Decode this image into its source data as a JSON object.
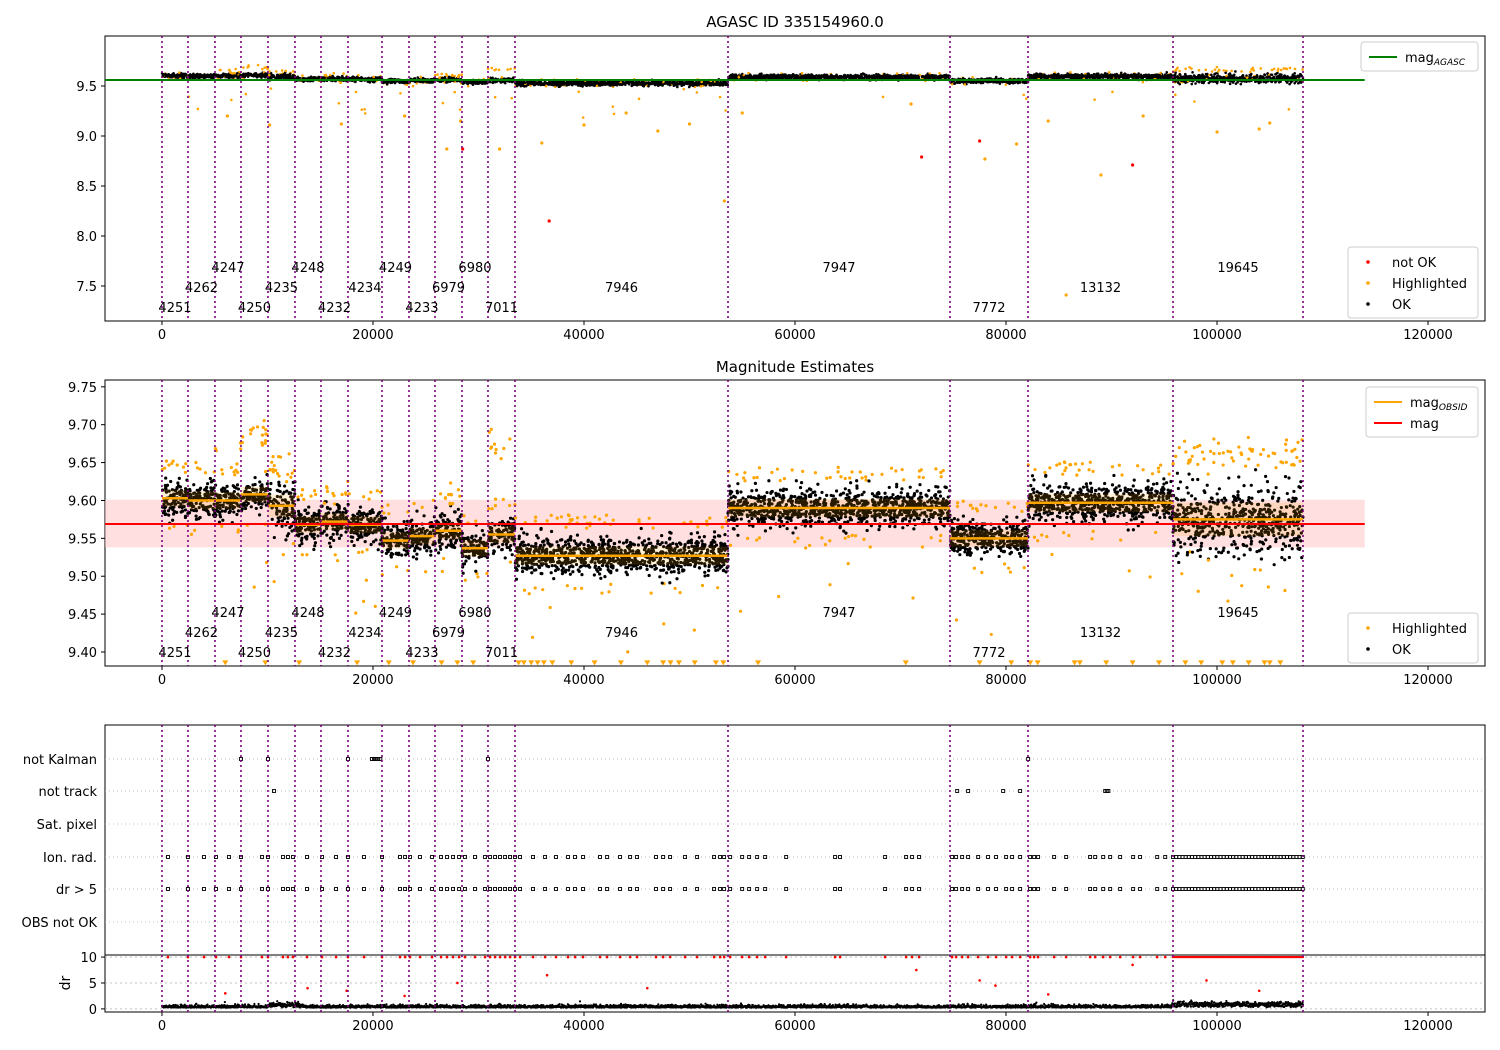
{
  "chart_data": [
    {
      "type": "scatter",
      "title": "AGASC ID 335154960.0",
      "xlabel": "",
      "ylabel": "",
      "xlim": [
        -5400,
        125400
      ],
      "ylim": [
        7.15,
        10.0
      ],
      "x_ticks": [
        0,
        20000,
        40000,
        60000,
        80000,
        100000,
        120000
      ],
      "y_ticks": [
        7.5,
        8.0,
        8.5,
        9.0,
        9.5
      ],
      "mag_agasc": 9.56,
      "legend_upper": {
        "position": "top-right",
        "entries": [
          {
            "label": "mag",
            "sub": "AGASC",
            "color": "#008000"
          }
        ]
      },
      "legend_lower": {
        "position": "bottom-right",
        "entries": [
          {
            "label": "not OK",
            "color": "#ff0000"
          },
          {
            "label": "Highlighted",
            "color": "#ffa500"
          },
          {
            "label": "OK",
            "color": "#000000"
          }
        ]
      },
      "not_ok_points": [
        [
          28500,
          8.87
        ],
        [
          36700,
          8.15
        ],
        [
          72000,
          8.79
        ],
        [
          77500,
          8.95
        ],
        [
          92000,
          8.71
        ]
      ],
      "highlighted_outliers": [
        [
          6200,
          9.2
        ],
        [
          10200,
          9.11
        ],
        [
          17000,
          9.12
        ],
        [
          23000,
          9.2
        ],
        [
          27000,
          8.87
        ],
        [
          28300,
          9.15
        ],
        [
          32000,
          8.87
        ],
        [
          36000,
          8.93
        ],
        [
          40000,
          9.11
        ],
        [
          44000,
          9.23
        ],
        [
          47000,
          9.05
        ],
        [
          50000,
          9.12
        ],
        [
          53300,
          8.35
        ],
        [
          55000,
          9.23
        ],
        [
          71000,
          9.32
        ],
        [
          78000,
          8.77
        ],
        [
          81000,
          8.92
        ],
        [
          84000,
          9.15
        ],
        [
          85700,
          7.41
        ],
        [
          89000,
          8.61
        ],
        [
          93000,
          9.2
        ],
        [
          100000,
          9.04
        ],
        [
          104000,
          9.07
        ],
        [
          105000,
          9.13
        ]
      ]
    },
    {
      "type": "scatter",
      "title": "Magnitude Estimates",
      "xlim": [
        -5400,
        125400
      ],
      "ylim": [
        9.3815,
        9.759
      ],
      "x_ticks": [
        0,
        20000,
        40000,
        60000,
        80000,
        100000,
        120000
      ],
      "y_ticks": [
        9.4,
        9.45,
        9.5,
        9.55,
        9.6,
        9.65,
        9.7,
        9.75
      ],
      "mag": 9.569,
      "mag_band": [
        9.538,
        9.601
      ],
      "legend_upper": {
        "position": "top-right",
        "entries": [
          {
            "label": "mag",
            "sub": "OBSID",
            "color": "#ffa500"
          },
          {
            "label": "mag",
            "sub": "",
            "color": "#ff0000"
          }
        ]
      },
      "legend_lower": {
        "position": "bottom-right",
        "entries": [
          {
            "label": "Highlighted",
            "color": "#ffa500"
          },
          {
            "label": "OK",
            "color": "#000000"
          }
        ]
      },
      "below_range_markers": [
        6000,
        9800,
        13000,
        18500,
        21500,
        23800,
        26500,
        28000,
        29500,
        33800,
        34300,
        35000,
        35600,
        36200,
        37000,
        38800,
        41000,
        43500,
        46000,
        47500,
        48200,
        49000,
        50500,
        52500,
        53200,
        56500,
        70500,
        77500,
        80500,
        82300,
        83000,
        86500,
        87000,
        89500,
        92000,
        94500,
        97000,
        98500,
        100500,
        101500,
        103000,
        104500,
        105000,
        106000
      ]
    },
    {
      "type": "scatter",
      "title": "",
      "xlim": [
        -5400,
        125400
      ],
      "flag_rows": [
        "not Kalman",
        "not track",
        "Sat. pixel",
        "Ion. rad.",
        "dr > 5",
        "OBS not OK"
      ],
      "not_kalman": [
        7490,
        10050,
        17630,
        19900,
        20100,
        20300,
        20500,
        20700,
        30900,
        82100
      ],
      "not_track": [
        10620,
        75370,
        76410,
        79730,
        81340,
        89400,
        89550,
        89700
      ],
      "ion_rad": [
        570,
        2460,
        3980,
        5120,
        6350,
        7490,
        9480,
        10050,
        11470,
        11940,
        12420,
        13750,
        15170,
        16500,
        17630,
        19150,
        20860,
        22560,
        23040,
        23510,
        24460,
        25600,
        26450,
        27020,
        27590,
        28160,
        28720,
        29670,
        30620,
        31090,
        31570,
        32040,
        32520,
        32990,
        33460,
        33940,
        35170,
        36310,
        37350,
        38490,
        39150,
        39910,
        41520,
        42190,
        43420,
        44370,
        45030,
        46830,
        47500,
        48160,
        49580,
        50720,
        52330,
        52900,
        53280,
        53850,
        54990,
        55650,
        56410,
        57170,
        59160,
        63800,
        64270,
        68540,
        70530,
        71100,
        71760,
        74890,
        75270,
        75840,
        76410,
        77360,
        78300,
        79060,
        80010,
        80580,
        81340,
        82280,
        82660,
        83040,
        84560,
        85700,
        87970,
        88450,
        89210,
        89870,
        90820,
        92050,
        92710,
        94330,
        95090
      ],
      "ion_rad_continuous": [
        95829,
        108152
      ],
      "dr_ylabel": "dr",
      "dr_ticks": [
        0,
        5,
        10
      ],
      "dr_ylim": [
        -0.6,
        10.4
      ],
      "dr_mid_values": [
        [
          6000,
          3
        ],
        [
          13800,
          4
        ],
        [
          17500,
          3.5
        ],
        [
          23000,
          2.5
        ],
        [
          28000,
          5
        ],
        [
          36500,
          6.5
        ],
        [
          46000,
          4
        ],
        [
          71500,
          7.5
        ],
        [
          77500,
          5.5
        ],
        [
          79000,
          4.5
        ],
        [
          84000,
          2.8
        ],
        [
          92000,
          8.5
        ],
        [
          99000,
          5.5
        ],
        [
          104000,
          3.5
        ]
      ]
    }
  ],
  "obsid_boundaries": [
    0,
    2464,
    5024,
    7488,
    10047,
    12607,
    15071,
    17630,
    20853,
    23412,
    25877,
    28436,
    30900,
    33460,
    53650,
    74692,
    82085,
    95829,
    108152
  ],
  "segments": [
    {
      "obsid": "4251",
      "mean": 9.603,
      "std": 0.011,
      "row": 0
    },
    {
      "obsid": "4262",
      "mean": 9.6,
      "std": 0.012,
      "row": 1
    },
    {
      "obsid": "4247",
      "mean": 9.6,
      "std": 0.011,
      "row": 2,
      "highlight_mag": 9.655
    },
    {
      "obsid": "4250",
      "mean": 9.608,
      "std": 0.01,
      "row": 0,
      "highlight_mag": 9.69
    },
    {
      "obsid": "4235",
      "mean": 9.593,
      "std": 0.015,
      "row": 1,
      "highlight_mag": 9.64
    },
    {
      "obsid": "4248",
      "mean": 9.568,
      "std": 0.011,
      "row": 2
    },
    {
      "obsid": "4232",
      "mean": 9.572,
      "std": 0.011,
      "row": 0,
      "highlight_mag": 9.605
    },
    {
      "obsid": "4234",
      "mean": 9.568,
      "std": 0.011,
      "row": 1
    },
    {
      "obsid": "4249",
      "mean": 9.547,
      "std": 0.011,
      "row": 2
    },
    {
      "obsid": "4233",
      "mean": 9.553,
      "std": 0.011,
      "row": 0
    },
    {
      "obsid": "6979",
      "mean": 9.56,
      "std": 0.011,
      "row": 1,
      "highlight_mag": 9.6
    },
    {
      "obsid": "6980",
      "mean": 9.537,
      "std": 0.011,
      "row": 2
    },
    {
      "obsid": "7011",
      "mean": 9.555,
      "std": 0.011,
      "row": 0,
      "highlight_mag": 9.67
    },
    {
      "obsid": "7946",
      "mean": 9.527,
      "std": 0.012,
      "row": 1
    },
    {
      "obsid": "7947",
      "mean": 9.59,
      "std": 0.012,
      "row": 2
    },
    {
      "obsid": "7772",
      "mean": 9.55,
      "std": 0.011,
      "row": 0
    },
    {
      "obsid": "13132",
      "mean": 9.597,
      "std": 0.012,
      "row": 1
    },
    {
      "obsid": "19645",
      "mean": 9.575,
      "std": 0.022,
      "row": 2,
      "highlight_mag": 9.66
    }
  ],
  "colors": {
    "ok": "#000000",
    "highlighted": "#ffa500",
    "not_ok": "#ff0000",
    "agasc": "#008000",
    "boundary": "#800080",
    "band": "#ffc0c0",
    "grid": "#b0b0b0"
  }
}
